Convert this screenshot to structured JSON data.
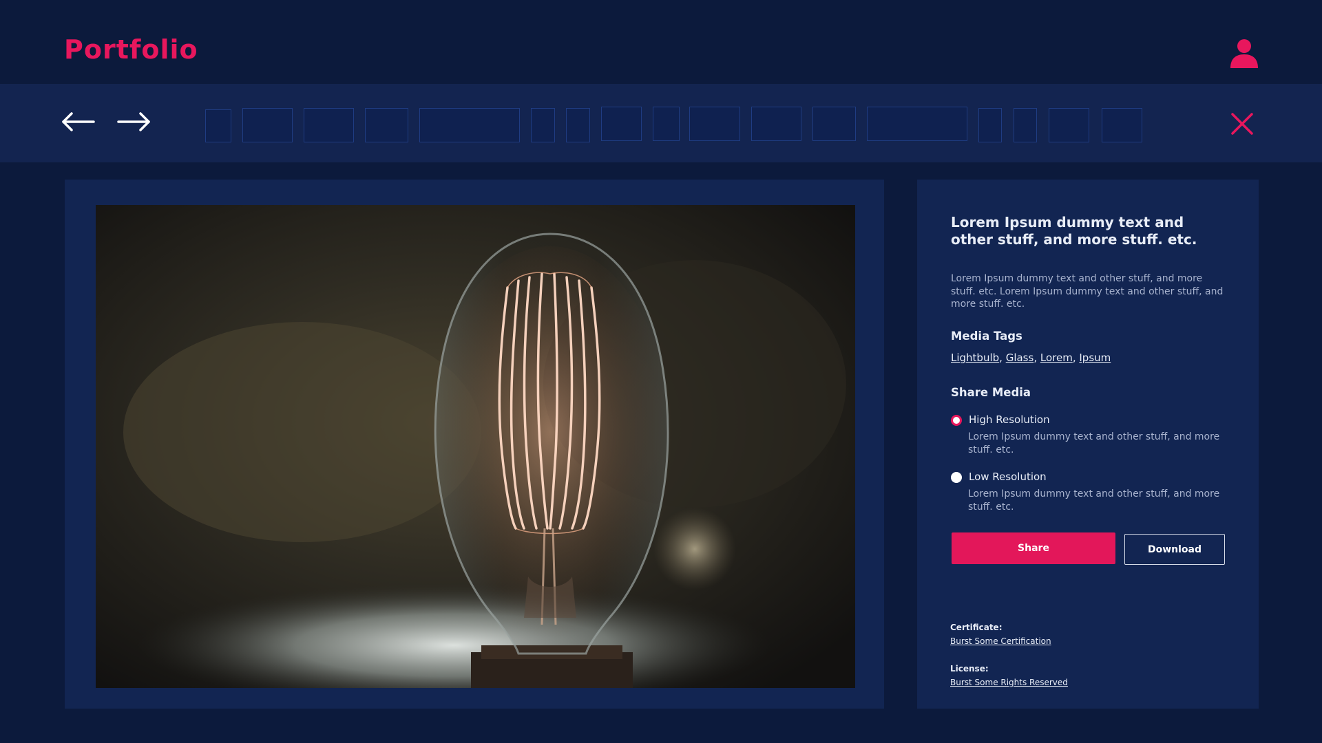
{
  "app": {
    "logo": "Portfolio",
    "accent_color": "#e8175d",
    "background_color": "#0c1a3c"
  },
  "header": {
    "user_icon": "user-icon"
  },
  "toolbar": {
    "prev_icon": "arrow-left-icon",
    "next_icon": "arrow-right-icon",
    "close_icon": "close-icon",
    "thumbnail_count": 17
  },
  "media": {
    "image": "lightbulb-photo"
  },
  "info": {
    "title": "Lorem Ipsum dummy text and other stuff, and more stuff. etc.",
    "description": "Lorem Ipsum dummy text and other stuff, and more stuff. etc. Lorem Ipsum dummy text and other stuff, and more stuff. etc.",
    "tags_heading": "Media Tags",
    "tags": [
      "Lightbulb",
      "Glass",
      "Lorem",
      "Ipsum"
    ],
    "share_heading": "Share Media",
    "options": [
      {
        "label": "High Resolution",
        "description": "Lorem Ipsum dummy text and other stuff, and more stuff. etc.",
        "selected": true
      },
      {
        "label": "Low Resolution",
        "description": "Lorem Ipsum dummy text and other stuff, and more stuff. etc.",
        "selected": false
      }
    ],
    "share_button": "Share",
    "download_button": "Download",
    "certificate_label": "Certificate:",
    "certificate_link": "Burst Some Certification",
    "license_label": "License:",
    "license_link": "Burst Some Rights Reserved"
  }
}
